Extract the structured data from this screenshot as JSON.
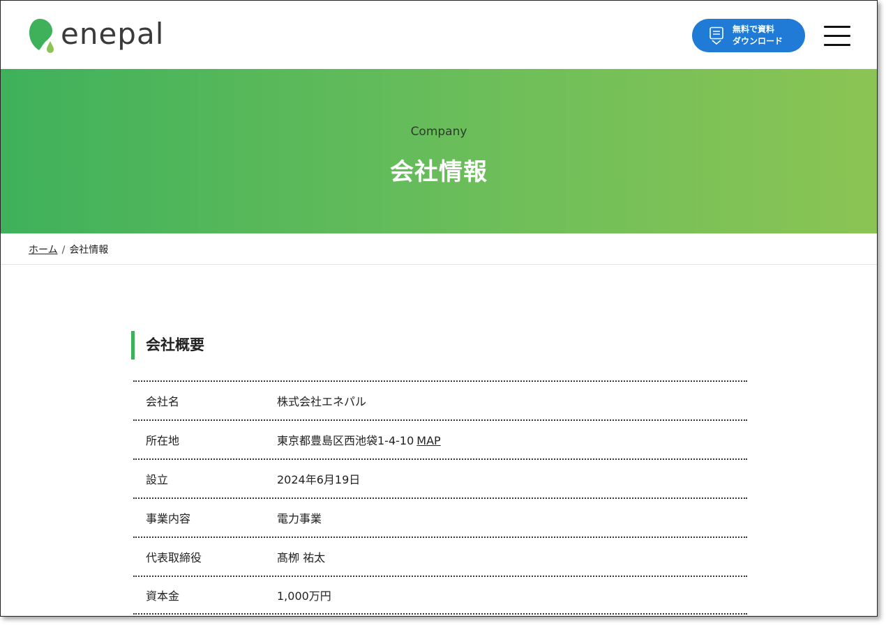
{
  "header": {
    "logo_text": "enepal",
    "download_button": {
      "line1": "無料で資料",
      "line2": "ダウンロード"
    },
    "menu_icon": "hamburger-icon"
  },
  "hero": {
    "subtitle": "Company",
    "title": "会社情報"
  },
  "breadcrumb": {
    "home": "ホーム",
    "separator": "/",
    "current": "会社情報"
  },
  "section": {
    "title": "会社概要",
    "rows": [
      {
        "label": "会社名",
        "value": "株式会社エネパル"
      },
      {
        "label": "所在地",
        "value": "東京都豊島区西池袋1-4-10",
        "link": "MAP"
      },
      {
        "label": "設立",
        "value": "2024年6月19日"
      },
      {
        "label": "事業内容",
        "value": "電力事業"
      },
      {
        "label": "代表取締役",
        "value": "髙栁 祐太"
      },
      {
        "label": "資本金",
        "value": "1,000万円"
      }
    ]
  },
  "colors": {
    "brand_green": "#3fb15b",
    "brand_green_light": "#8bc454",
    "button_blue": "#1f7bd6"
  }
}
